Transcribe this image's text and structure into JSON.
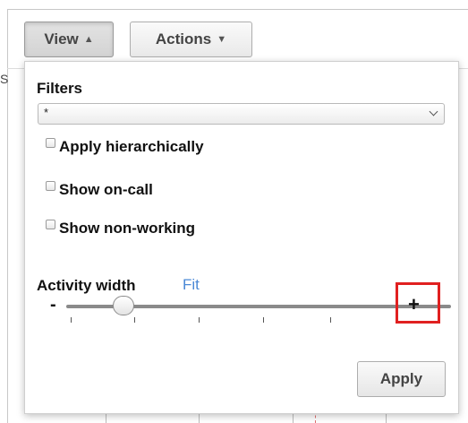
{
  "toolbar": {
    "view_label": "View",
    "view_caret": "▲",
    "actions_label": "Actions",
    "actions_caret": "▼"
  },
  "background": {
    "left_glyph": "S"
  },
  "panel": {
    "filters_label": "Filters",
    "filter_value": "*",
    "options": [
      {
        "label": "Apply hierarchically",
        "checked": false
      },
      {
        "label": "Show on-call",
        "checked": false
      },
      {
        "label": "Show non-working",
        "checked": false
      }
    ],
    "activity_width_label": "Activity width",
    "fit_link": "Fit",
    "slider": {
      "min_label": "-",
      "max_label": "+",
      "value_fraction": 0.15
    },
    "apply_label": "Apply"
  },
  "colors": {
    "link": "#4a88d6",
    "highlight": "#e02020"
  }
}
